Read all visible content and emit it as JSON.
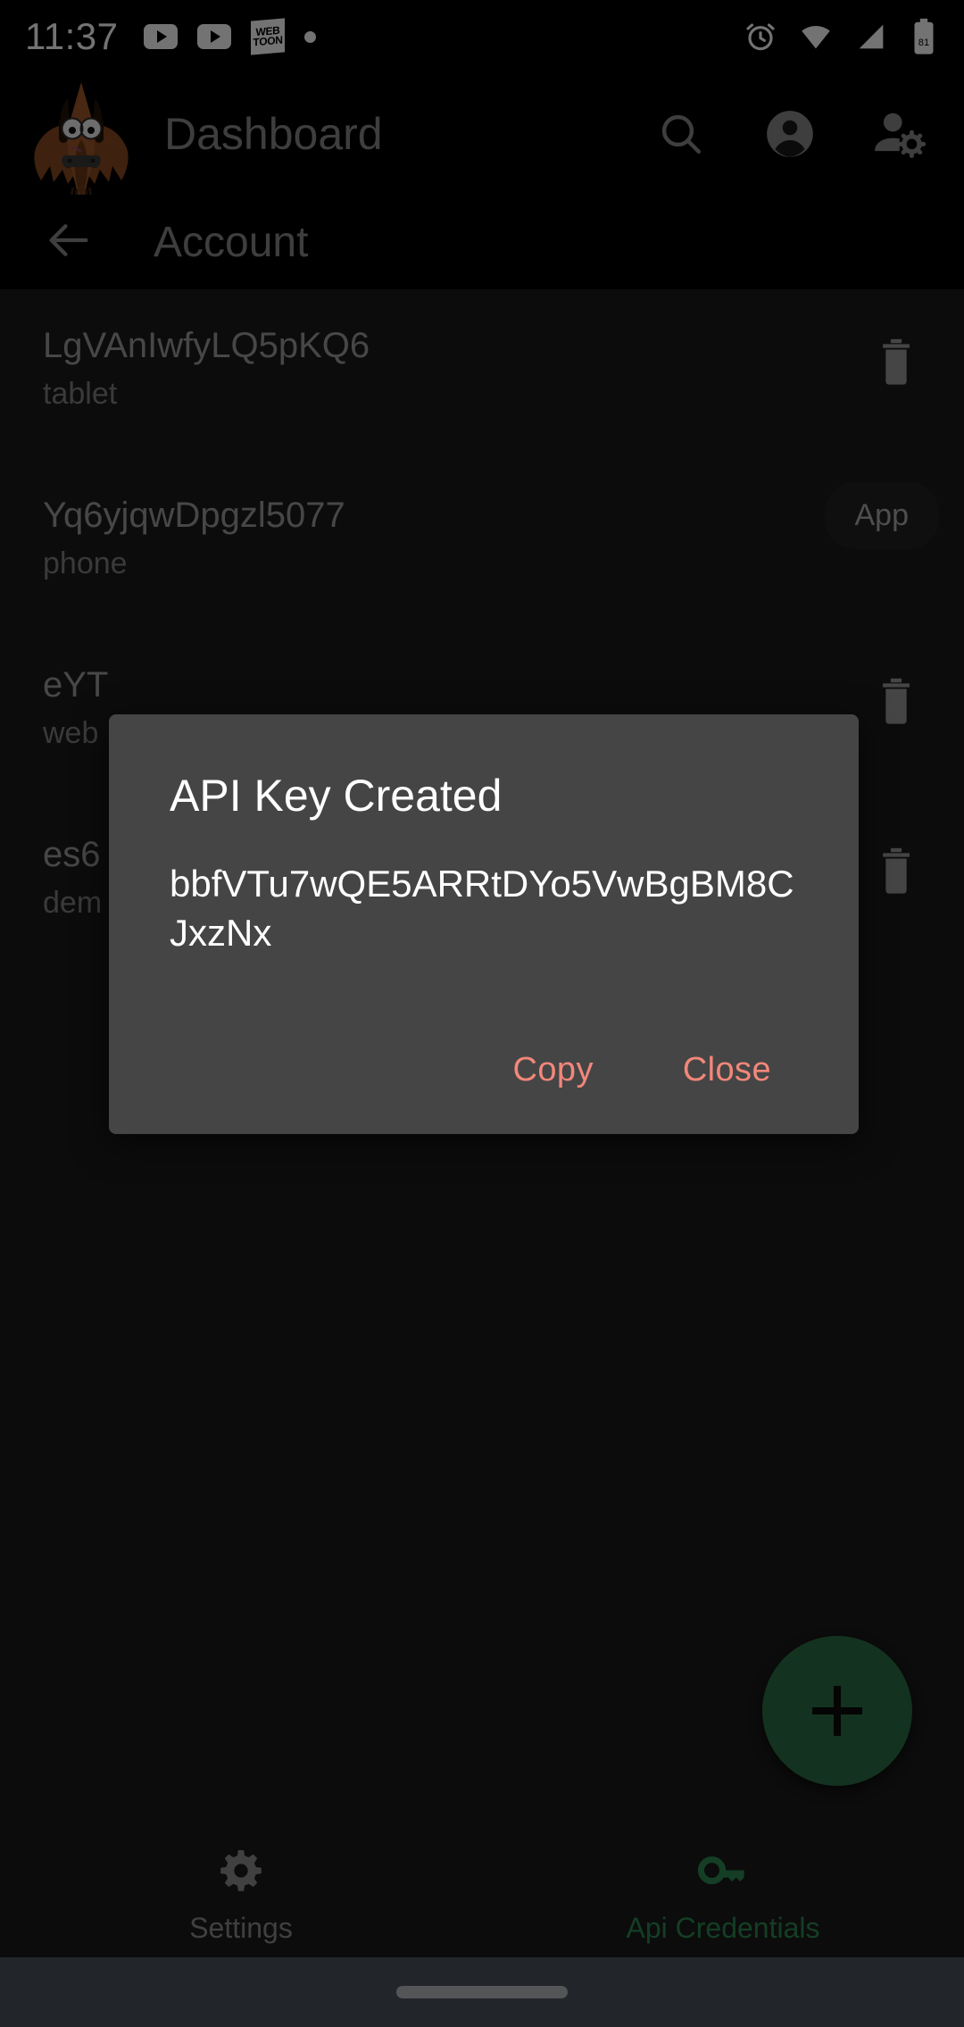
{
  "status_bar": {
    "clock": "11:37",
    "battery_level": "81",
    "left_icons": [
      "youtube-icon",
      "youtube-icon",
      "webtoon-icon",
      "dot-icon"
    ],
    "right_icons": [
      "alarm-icon",
      "wifi-icon",
      "signal-icon",
      "battery-icon"
    ],
    "webtoon_line1": "WEB",
    "webtoon_line2": "TOON"
  },
  "app_bar": {
    "title": "Dashboard",
    "logo_name": "bat-mascot-logo",
    "actions": [
      {
        "name": "search-icon",
        "label": "Search"
      },
      {
        "name": "account-circle-icon",
        "label": "Account"
      },
      {
        "name": "manage-accounts-icon",
        "label": "Manage accounts"
      }
    ]
  },
  "sub_header": {
    "back_label": "Back",
    "title": "Account"
  },
  "list": {
    "rows": [
      {
        "title": "LgVAnIwfyLQ5pKQ6",
        "subtitle": "tablet",
        "trash": "delete-icon"
      },
      {
        "title": "Yq6yjqwDpgzl5077",
        "subtitle": "phone",
        "trash": "delete-icon",
        "chip": "App"
      },
      {
        "title": "eYT",
        "subtitle": "web",
        "trash": "delete-icon"
      },
      {
        "title": "es6",
        "subtitle": "dem",
        "trash": "delete-icon"
      }
    ]
  },
  "fab": {
    "name": "add-api-key-fab",
    "icon": "plus-icon",
    "color": "#2b7045"
  },
  "bottom_nav": {
    "items": [
      {
        "label": "Settings",
        "icon": "gear-icon",
        "active": false,
        "color": "#8e8e8e"
      },
      {
        "label": "Api Credentials",
        "icon": "key-icon",
        "active": true,
        "color": "#2d8a52"
      }
    ]
  },
  "dialog": {
    "title": "API Key Created",
    "api_key": "bbfVTu7wQE5ARRtDYo5VwBgBM8CJxzNx",
    "copy_label": "Copy",
    "close_label": "Close",
    "action_color": "#f2877a",
    "surface_color": "#454545"
  }
}
